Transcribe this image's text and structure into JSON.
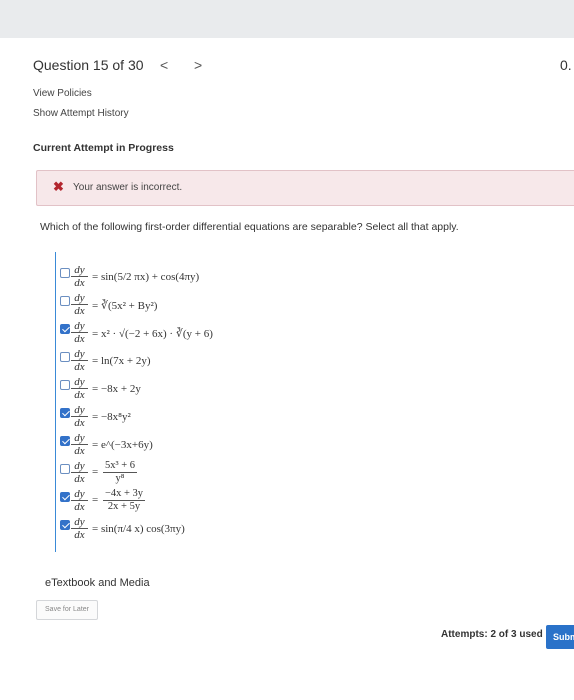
{
  "header": {
    "question_label": "Question 15 of 30",
    "prev_icon": "chevron-left-icon",
    "prev_glyph": "<",
    "next_icon": "chevron-right-icon",
    "next_glyph": ">",
    "score_text": "0."
  },
  "links": {
    "view_policies": "View Policies",
    "show_attempt_history": "Show Attempt History"
  },
  "attempt_state": "Current Attempt in Progress",
  "feedback": {
    "icon": "x-icon",
    "glyph": "✖",
    "text": "Your answer is incorrect.",
    "color": "#b3262f"
  },
  "question": {
    "prompt": "Which of the following first-order differential equations are separable? Select all that apply.",
    "lhs": {
      "num": "dy",
      "den": "dx"
    },
    "options": [
      {
        "checked": false,
        "rhs": "= sin(5/2 πx) + cos(4πy)"
      },
      {
        "checked": false,
        "rhs": "= ∛(5x² + By²)"
      },
      {
        "checked": true,
        "rhs": "= x² · √(−2 + 6x) · ∛(y + 6)"
      },
      {
        "checked": false,
        "rhs": "= ln(7x + 2y)"
      },
      {
        "checked": false,
        "rhs": "= −8x + 2y"
      },
      {
        "checked": true,
        "rhs": "= −8x⁸y²"
      },
      {
        "checked": true,
        "rhs": "= e^(−3x+6y)"
      },
      {
        "checked": false,
        "rhs_num": "5x³ + 6",
        "rhs_den": "y⁸"
      },
      {
        "checked": true,
        "rhs_num": "−4x + 3y",
        "rhs_den": "2x + 5y"
      },
      {
        "checked": true,
        "rhs": "= sin(π/4 x) cos(3πy)"
      }
    ]
  },
  "etextbook": "eTextbook and Media",
  "save_for_later": "Save for Later",
  "attempts": "Attempts: 2 of 3 used",
  "submit": "Subm",
  "colors": {
    "accent": "#2a72c9",
    "error_bg": "#f7e8ea"
  }
}
